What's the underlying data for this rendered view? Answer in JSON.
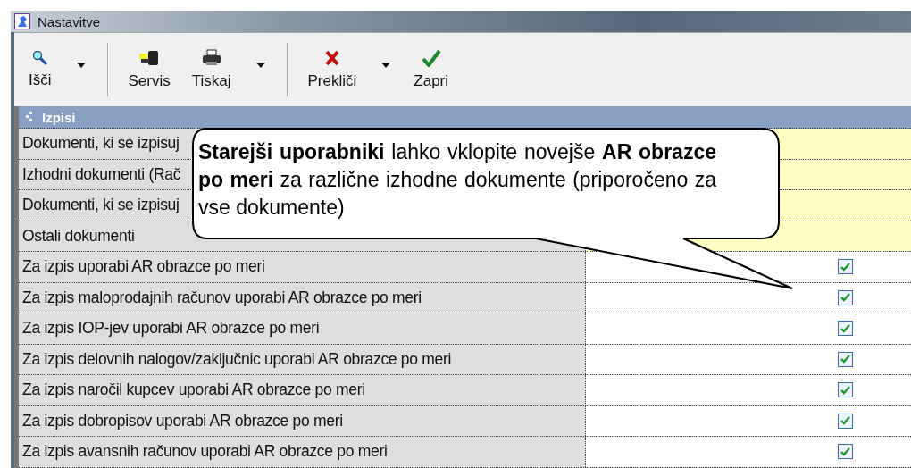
{
  "window": {
    "title": "Nastavitve"
  },
  "toolbar": {
    "groups": [
      [
        {
          "label": "Išči",
          "kind": "search",
          "dropdown": true
        }
      ],
      [
        {
          "label": "Servis",
          "kind": "service",
          "dropdown": false
        },
        {
          "label": "Tiskaj",
          "kind": "print",
          "dropdown": true
        }
      ],
      [
        {
          "label": "Prekliči",
          "kind": "cancel",
          "dropdown": true
        },
        {
          "label": "Zapri",
          "kind": "close",
          "dropdown": false
        }
      ]
    ]
  },
  "section": {
    "title": "Izpisi"
  },
  "rows": [
    {
      "label": "Dokumenti, ki se izpisuj",
      "kind": "category"
    },
    {
      "label": "Izhodni dokumenti (Rač",
      "kind": "category"
    },
    {
      "label": "Dokumenti, ki se izpisuj",
      "kind": "category"
    },
    {
      "label": "Ostali dokumenti",
      "kind": "category"
    },
    {
      "label": "Za izpis uporabi AR obrazce po meri",
      "kind": "checkbox",
      "checked": true
    },
    {
      "label": "Za izpis maloprodajnih računov uporabi AR obrazce po meri",
      "kind": "checkbox",
      "checked": true
    },
    {
      "label": "Za izpis IOP-jev uporabi AR obrazce po meri",
      "kind": "checkbox",
      "checked": true
    },
    {
      "label": "Za izpis delovnih nalogov/zaključnic uporabi AR obrazce po meri",
      "kind": "checkbox",
      "checked": true
    },
    {
      "label": "Za izpis naročil kupcev uporabi AR obrazce po meri",
      "kind": "checkbox",
      "checked": true
    },
    {
      "label": "Za izpis dobropisov uporabi AR obrazce po meri",
      "kind": "checkbox",
      "checked": true
    },
    {
      "label": "Za izpis avansnih računov uporabi AR obrazce po meri",
      "kind": "checkbox",
      "checked": true
    }
  ],
  "callout": {
    "text": "**Starejši uporabniki** lahko vklopite novejše **AR obrazce po meri** za različne izhodne dokumente (priporočeno za vse dokumente)"
  }
}
